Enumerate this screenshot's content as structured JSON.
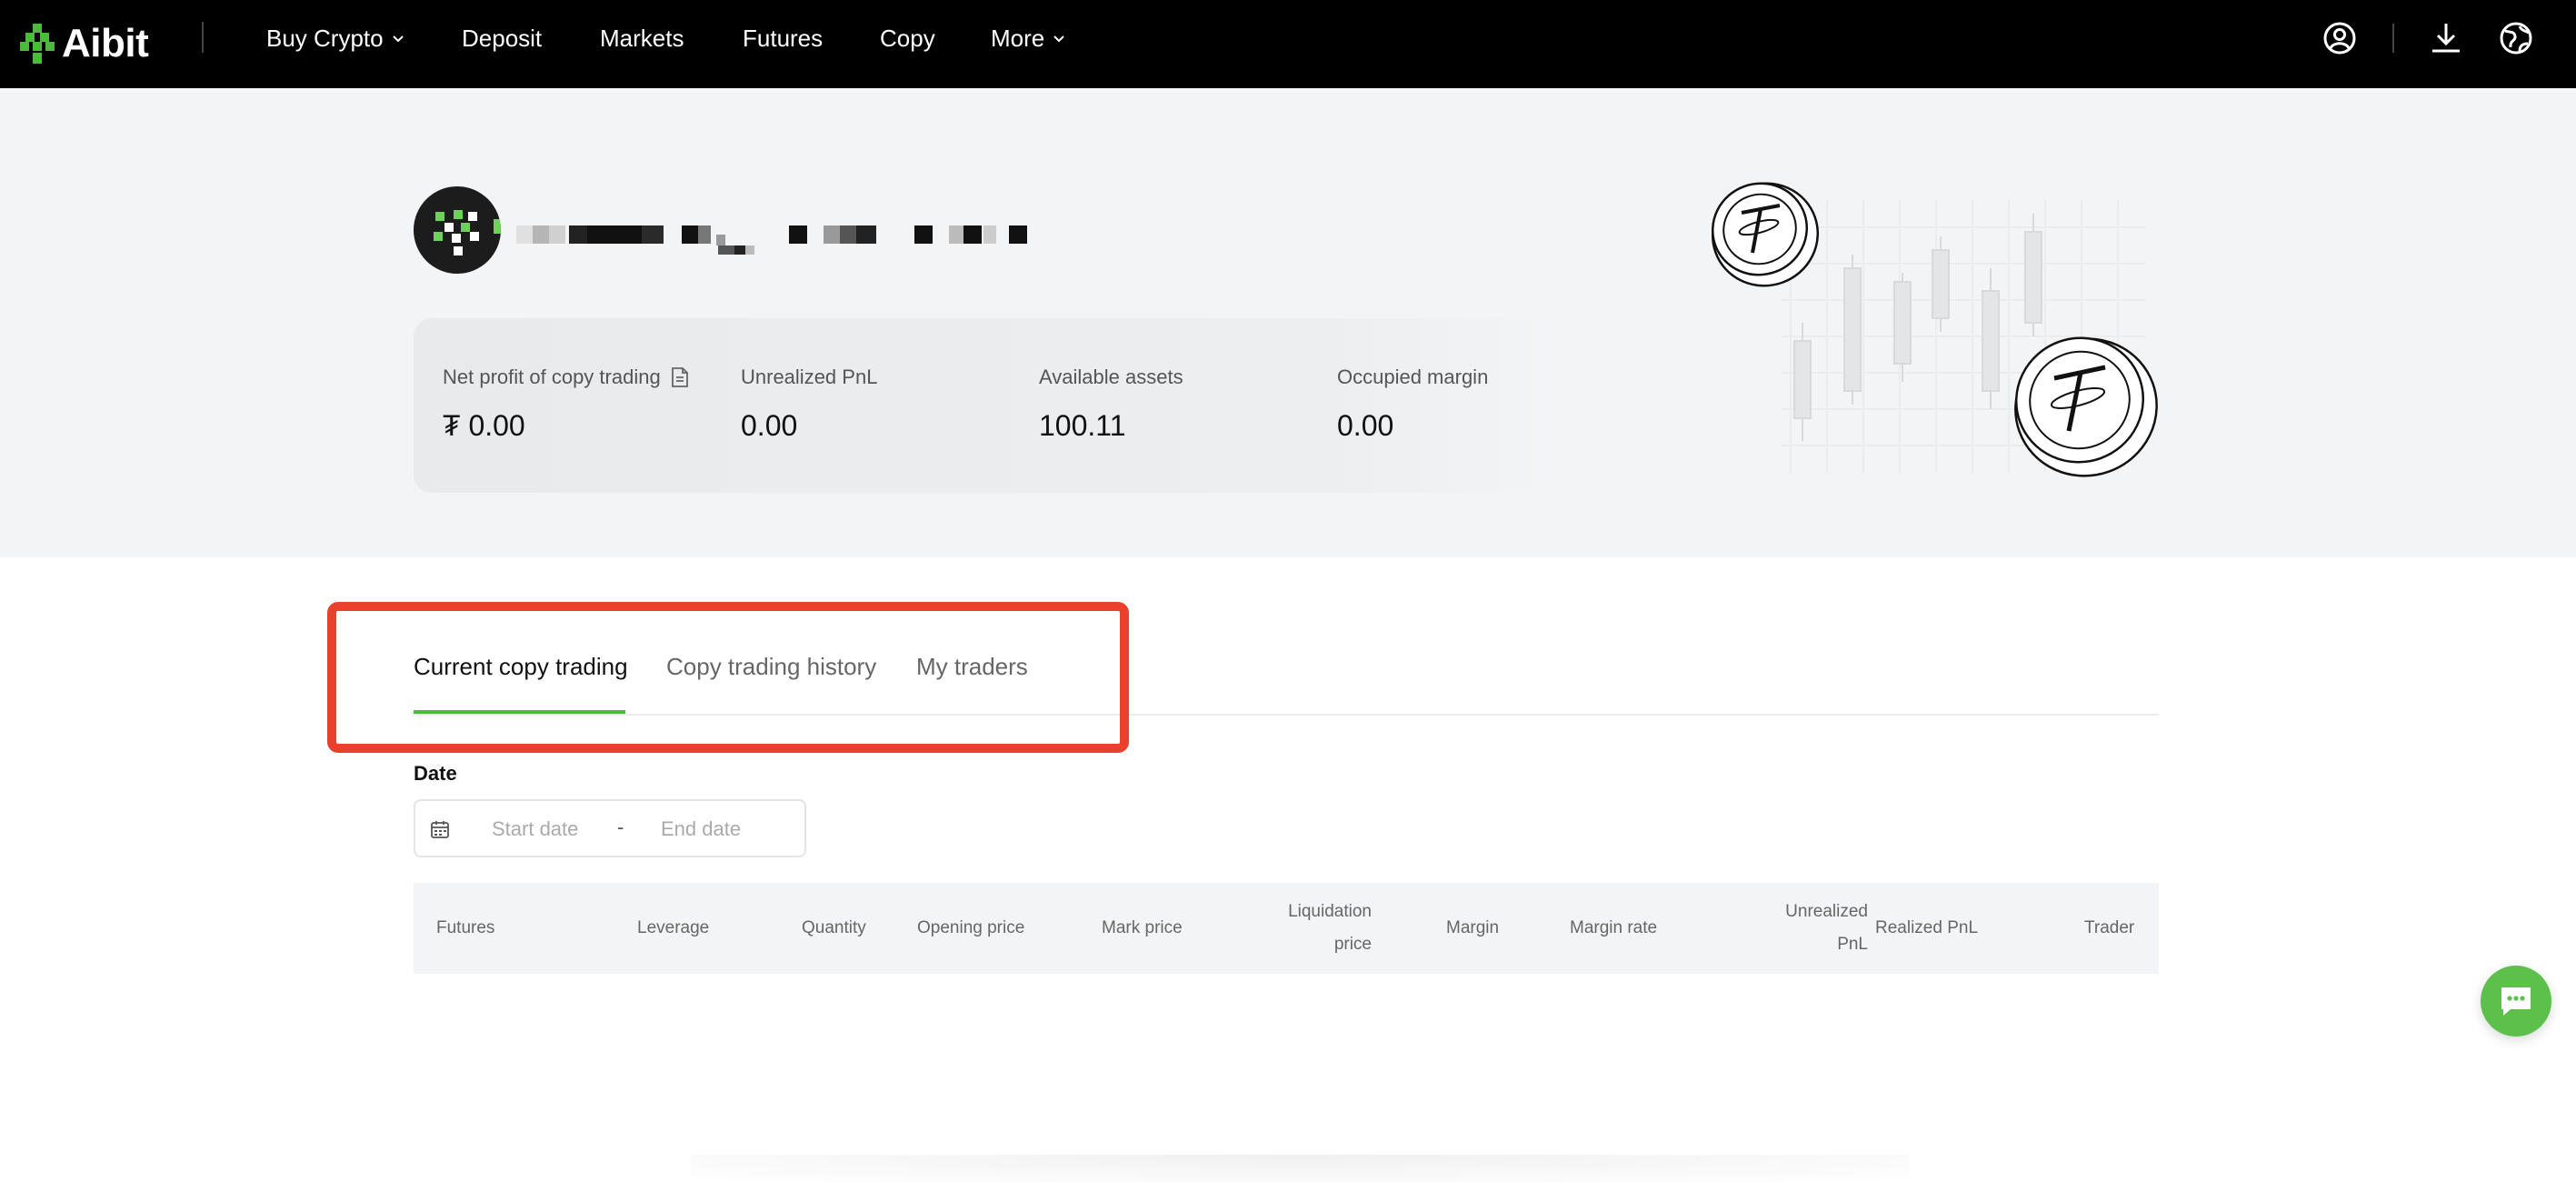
{
  "brand": {
    "name": "Aibit",
    "accent": "#4cba3b",
    "highlight": "#e8412c"
  },
  "nav": {
    "items": [
      {
        "label": "Buy Crypto",
        "has_dropdown": true
      },
      {
        "label": "Deposit",
        "has_dropdown": false
      },
      {
        "label": "Markets",
        "has_dropdown": false
      },
      {
        "label": "Futures",
        "has_dropdown": false
      },
      {
        "label": "Copy",
        "has_dropdown": false
      },
      {
        "label": "More",
        "has_dropdown": true
      }
    ],
    "icons": [
      "user-icon",
      "download-icon",
      "globe-icon"
    ]
  },
  "profile": {
    "username": "(redacted)"
  },
  "stats": [
    {
      "label": "Net profit of copy trading",
      "value": "₮ 0.00",
      "has_doc_icon": true
    },
    {
      "label": "Unrealized PnL",
      "value": "0.00"
    },
    {
      "label": "Available assets",
      "value": "100.11"
    },
    {
      "label": "Occupied margin",
      "value": "0.00"
    }
  ],
  "tabs": [
    {
      "label": "Current copy trading",
      "active": true
    },
    {
      "label": "Copy trading history",
      "active": false
    },
    {
      "label": "My traders",
      "active": false
    }
  ],
  "filter": {
    "date_label": "Date",
    "start_placeholder": "Start date",
    "separator": "-",
    "end_placeholder": "End date"
  },
  "table": {
    "columns": [
      "Futures",
      "Leverage",
      "Quantity",
      "Opening price",
      "Mark price",
      "Liquidation price",
      "Margin",
      "Margin rate",
      "Unrealized PnL",
      "Realized PnL",
      "Trader"
    ],
    "col_labels_split": {
      "liq_line1": "Liquidation",
      "liq_line2": "price",
      "upnl_line1": "Unrealized",
      "upnl_line2": "PnL"
    },
    "rows": []
  },
  "chat": {
    "icon": "chat-icon"
  }
}
